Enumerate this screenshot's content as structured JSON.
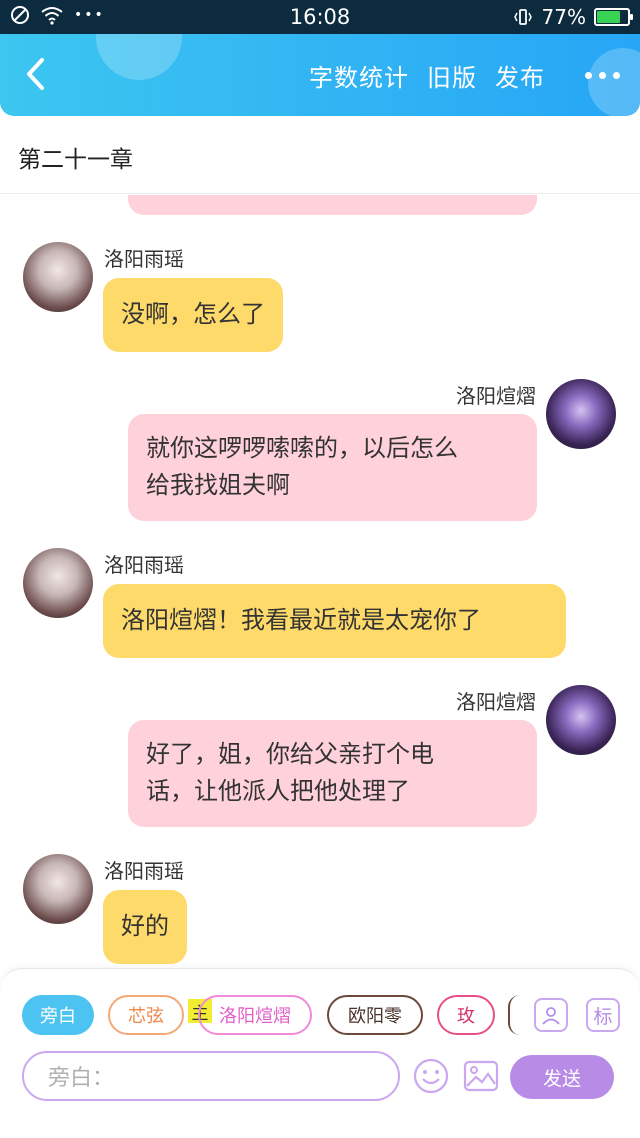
{
  "status_bar": {
    "time": "16:08",
    "battery_percent": "77%",
    "battery_level": 0.77,
    "more_dots": "•••"
  },
  "header": {
    "back_icon": "chevron-left-icon",
    "actions": [
      "字数统计",
      "旧版",
      "发布"
    ],
    "more_icon": "more-dots-icon"
  },
  "chapter": {
    "title": "第二十一章"
  },
  "messages": [
    {
      "side": "left",
      "speaker": "洛阳雨瑶",
      "text": [
        "没啊，怎么了"
      ]
    },
    {
      "side": "right",
      "speaker": "洛阳煊熠",
      "text": [
        "就你这啰啰嗦嗦的，以后怎么",
        "给我找姐夫啊"
      ]
    },
    {
      "side": "left",
      "speaker": "洛阳雨瑶",
      "text": [
        "洛阳煊熠！我看最近就是太宠你了"
      ]
    },
    {
      "side": "right",
      "speaker": "洛阳煊熠",
      "text": [
        "好了，姐，你给父亲打个电",
        "话，让他派人把他处理了"
      ]
    },
    {
      "side": "left",
      "speaker": "洛阳雨瑶",
      "text": [
        "好的"
      ]
    }
  ],
  "composer": {
    "role_chips": [
      {
        "label": "旁白",
        "style": "selected"
      },
      {
        "label": "芯弦",
        "style": "orange"
      },
      {
        "label": "洛阳煊熠",
        "style": "pink"
      },
      {
        "label": "欧阳零",
        "style": "brown"
      },
      {
        "label": "玫",
        "style": "rose"
      }
    ],
    "main_tag": "主",
    "tag_button": "标",
    "input_placeholder": "旁白：",
    "send_label": "发送"
  },
  "colors": {
    "header_start": "#3cc6f0",
    "header_end": "#26a6f5",
    "bubble_left": "#fdda6a",
    "bubble_right": "#ffd1da",
    "accent_purple": "#b78be6",
    "selected_chip": "#4cc3f1"
  }
}
